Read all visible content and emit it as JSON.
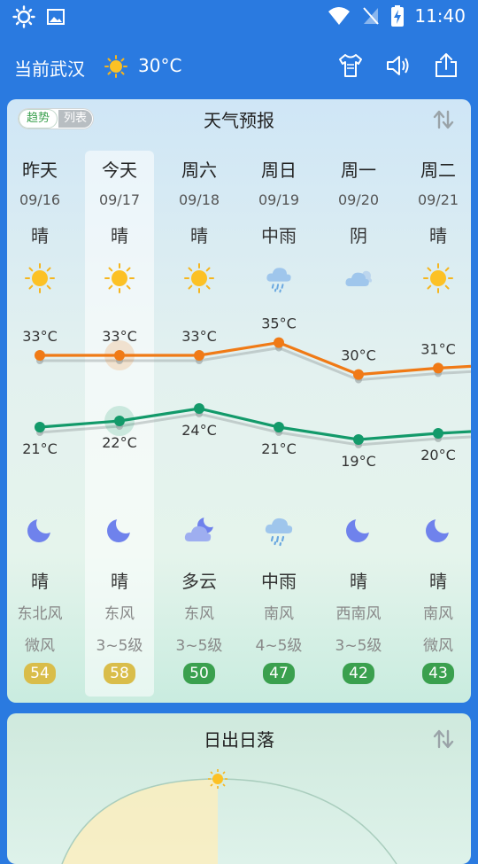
{
  "status_bar": {
    "time": "11:40"
  },
  "header": {
    "location": "当前武汉",
    "current_temp": "30°C"
  },
  "forecast_card": {
    "title": "天气预报",
    "toggle": {
      "active": "趋势",
      "inactive": "列表"
    },
    "days": [
      {
        "dow": "昨天",
        "date": "09/16",
        "day_cond": "晴",
        "day_icon": "sun-icon",
        "high": "33°C",
        "low": "21°C",
        "night_icon": "moon-icon",
        "night_cond": "晴",
        "wind_dir": "东北风",
        "wind_level": "微风",
        "aqi": "54",
        "aqi_color": "#d9bd4a"
      },
      {
        "dow": "今天",
        "date": "09/17",
        "day_cond": "晴",
        "day_icon": "sun-icon",
        "high": "33°C",
        "low": "22°C",
        "night_icon": "moon-icon",
        "night_cond": "晴",
        "wind_dir": "东风",
        "wind_level": "3~5级",
        "aqi": "58",
        "aqi_color": "#d9bd4a"
      },
      {
        "dow": "周六",
        "date": "09/18",
        "day_cond": "晴",
        "day_icon": "sun-icon",
        "high": "33°C",
        "low": "24°C",
        "night_icon": "cloudy-night-icon",
        "night_cond": "多云",
        "wind_dir": "东风",
        "wind_level": "3~5级",
        "aqi": "50",
        "aqi_color": "#3aa04e"
      },
      {
        "dow": "周日",
        "date": "09/19",
        "day_cond": "中雨",
        "day_icon": "rain-icon",
        "high": "35°C",
        "low": "21°C",
        "night_icon": "rain-icon",
        "night_cond": "中雨",
        "wind_dir": "南风",
        "wind_level": "4~5级",
        "aqi": "47",
        "aqi_color": "#3aa04e"
      },
      {
        "dow": "周一",
        "date": "09/20",
        "day_cond": "阴",
        "day_icon": "overcast-icon",
        "high": "30°C",
        "low": "19°C",
        "night_icon": "moon-icon",
        "night_cond": "晴",
        "wind_dir": "西南风",
        "wind_level": "3~5级",
        "aqi": "42",
        "aqi_color": "#3aa04e"
      },
      {
        "dow": "周二",
        "date": "09/21",
        "day_cond": "晴",
        "day_icon": "sun-icon",
        "high": "31°C",
        "low": "20°C",
        "night_icon": "moon-icon",
        "night_cond": "晴",
        "wind_dir": "南风",
        "wind_level": "微风",
        "aqi": "43",
        "aqi_color": "#3aa04e"
      }
    ],
    "high_color": "#f07a16",
    "low_color": "#139a6a"
  },
  "sun_card": {
    "title": "日出日落"
  }
}
